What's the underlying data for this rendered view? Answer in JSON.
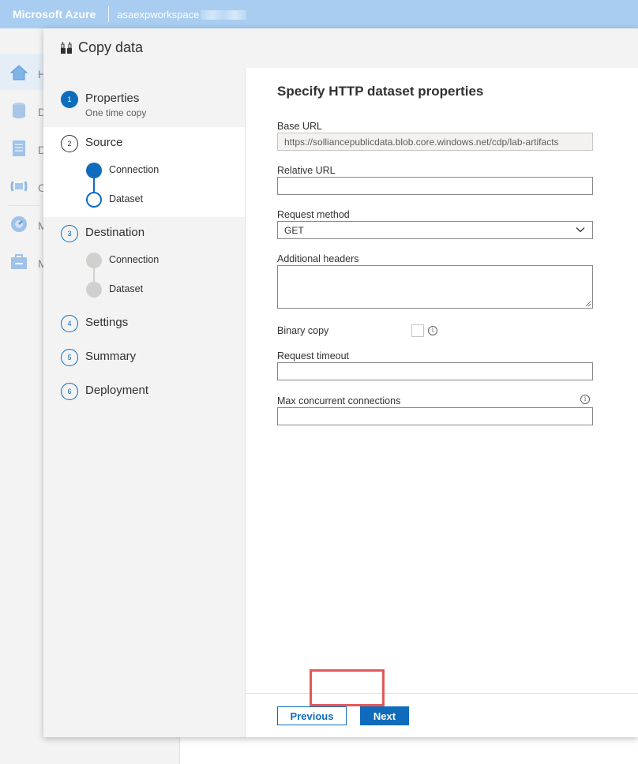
{
  "topbar": {
    "brand": "Microsoft Azure",
    "workspace": "asaexpworkspace"
  },
  "background_rail": {
    "items": [
      {
        "icon": "home-icon",
        "letter": "H"
      },
      {
        "icon": "data-icon",
        "letter": "D"
      },
      {
        "icon": "develop-icon",
        "letter": "D"
      },
      {
        "icon": "integrate-icon",
        "letter": "O"
      },
      {
        "icon": "monitor-icon",
        "letter": "M"
      },
      {
        "icon": "manage-icon",
        "letter": "M"
      }
    ]
  },
  "dialog": {
    "title": "Copy data",
    "title_icon": "copy-data-icon",
    "steps": [
      {
        "number": "1",
        "label": "Properties",
        "sub": "One time copy",
        "state": "completed"
      },
      {
        "number": "2",
        "label": "Source",
        "state": "active",
        "substeps": [
          {
            "label": "Connection",
            "state": "completed"
          },
          {
            "label": "Dataset",
            "state": "current"
          }
        ]
      },
      {
        "number": "3",
        "label": "Destination",
        "state": "pending",
        "substeps": [
          {
            "label": "Connection",
            "state": "pending"
          },
          {
            "label": "Dataset",
            "state": "pending"
          }
        ]
      },
      {
        "number": "4",
        "label": "Settings",
        "state": "pending"
      },
      {
        "number": "5",
        "label": "Summary",
        "state": "pending"
      },
      {
        "number": "6",
        "label": "Deployment",
        "state": "pending"
      }
    ]
  },
  "form": {
    "title": "Specify HTTP dataset properties",
    "base_url": {
      "label": "Base URL",
      "value": "https://solliancepublicdata.blob.core.windows.net/cdp/lab-artifacts"
    },
    "relative_url": {
      "label": "Relative URL",
      "value": ""
    },
    "request_method": {
      "label": "Request method",
      "value": "GET"
    },
    "additional_headers": {
      "label": "Additional headers",
      "value": ""
    },
    "binary_copy": {
      "label": "Binary copy",
      "checked": false
    },
    "request_timeout": {
      "label": "Request timeout",
      "value": ""
    },
    "max_concurrent": {
      "label": "Max concurrent connections",
      "value": ""
    }
  },
  "footer": {
    "previous_label": "Previous",
    "next_label": "Next"
  },
  "colors": {
    "accent": "#0f6cbd",
    "topbar": "#a9cdf0",
    "highlight": "#e05a5a"
  }
}
